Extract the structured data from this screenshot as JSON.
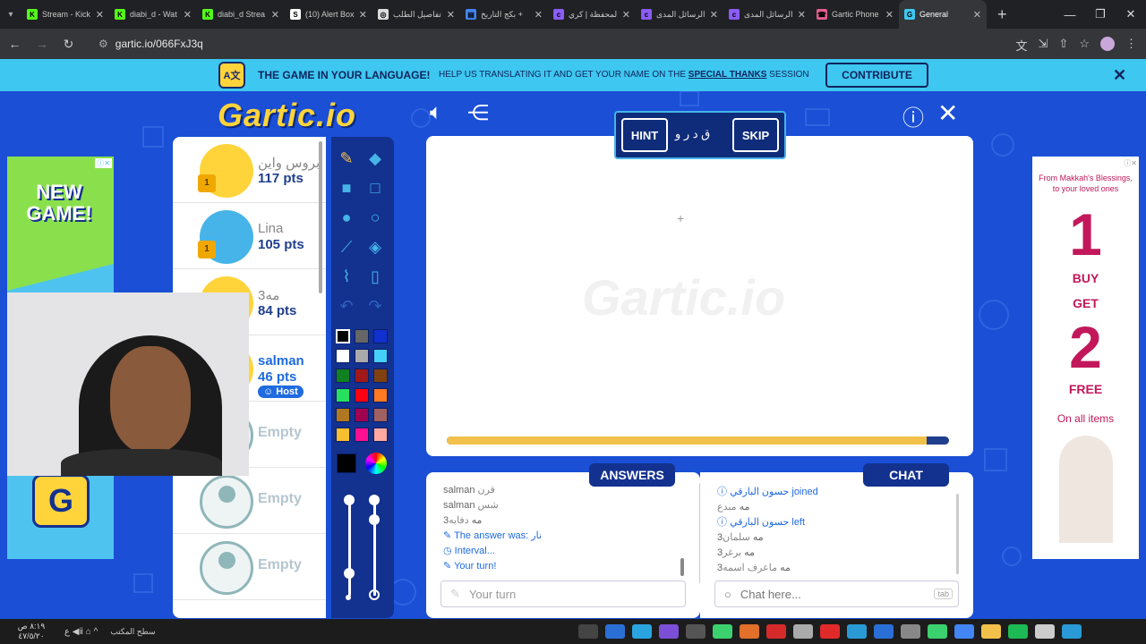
{
  "tabs": [
    {
      "label": "Stream - Kick",
      "color": "#53fc18",
      "glyph": "K"
    },
    {
      "label": "diabi_d - Wat",
      "color": "#53fc18",
      "glyph": "K"
    },
    {
      "label": "diabi_d Strea",
      "color": "#53fc18",
      "glyph": "K"
    },
    {
      "label": "(10) Alert Box",
      "color": "#ffffff",
      "glyph": "S"
    },
    {
      "label": "تفاصيل الطلب",
      "color": "#dddddd",
      "glyph": "◎"
    },
    {
      "label": "بكج التاريخ +",
      "color": "#4285f4",
      "glyph": "▤"
    },
    {
      "label": "المحفظة | كري",
      "color": "#8b5cf6",
      "glyph": "c"
    },
    {
      "label": "الرسائل المدى",
      "color": "#8b5cf6",
      "glyph": "c"
    },
    {
      "label": "الرسائل المدى",
      "color": "#8b5cf6",
      "glyph": "c"
    },
    {
      "label": "Gartic Phone",
      "color": "#e35d8f",
      "glyph": "☎"
    },
    {
      "label": "General",
      "color": "#3ec7f0",
      "glyph": "G"
    }
  ],
  "address": {
    "url": "gartic.io/066FxJ3q"
  },
  "banner": {
    "title": "THE GAME IN YOUR LANGUAGE!",
    "text_prefix": "HELP US TRANSLATING IT AND GET YOUR NAME ON THE",
    "text_bold": "SPECIAL THANKS",
    "text_suffix": "SESSION",
    "contribute_label": "CONTRIBUTE"
  },
  "logo_text": "Gartic.io",
  "players": [
    {
      "name": "بروس واين",
      "pts": "117 pts",
      "avatar": "yellow",
      "trophy": "1"
    },
    {
      "name": "Lina",
      "pts": "105 pts",
      "avatar": "blue",
      "trophy": "1"
    },
    {
      "name": "3مه",
      "pts": "84 pts",
      "avatar": "yellow"
    },
    {
      "name": "salman",
      "pts": "46 pts",
      "avatar": "yellow",
      "host": "Host"
    },
    {
      "name": "Empty",
      "avatar": "empty"
    },
    {
      "name": "Empty",
      "avatar": "empty"
    },
    {
      "name": "Empty",
      "avatar": "empty"
    }
  ],
  "hint": {
    "hint_label": "HINT",
    "word": "ق د ر و",
    "skip_label": "SKIP"
  },
  "canvas": {
    "watermark": "Gartic.io",
    "progress": 0.955
  },
  "colors": [
    "#000000",
    "#666666",
    "#1030d0",
    "#ffffff",
    "#aaaaaa",
    "#46d0f8",
    "#108020",
    "#a01818",
    "#804010",
    "#28e060",
    "#ff0010",
    "#ff7a20",
    "#b07820",
    "#a00050",
    "#a06060",
    "#f8c030",
    "#ff1090",
    "#ffaaa0"
  ],
  "answers": {
    "tab_label": "ANSWERS",
    "messages": [
      {
        "name": "salman",
        "text": "قرن",
        "type": "user"
      },
      {
        "name": "salman",
        "text": "شس",
        "type": "user"
      },
      {
        "name": "3مه",
        "text": "دفايه",
        "type": "user"
      },
      {
        "name": "",
        "text": "The answer was: نار",
        "type": "sys",
        "icon": "✎"
      },
      {
        "name": "",
        "text": "Interval...",
        "type": "sys",
        "icon": "◷"
      },
      {
        "name": "",
        "text": "Your turn!",
        "type": "sys",
        "icon": "✎"
      }
    ],
    "input_placeholder": "Your turn"
  },
  "chat": {
    "tab_label": "CHAT",
    "messages": [
      {
        "name": "",
        "text": "حسون البارقي joined",
        "type": "sys",
        "icon": "ⓘ"
      },
      {
        "name": "مه",
        "text": "مبدع",
        "type": "user"
      },
      {
        "name": "",
        "text": "حسون البارقي left",
        "type": "sys",
        "icon": "ⓘ"
      },
      {
        "name": "3مه",
        "text": "سلمان",
        "type": "user"
      },
      {
        "name": "3مه",
        "text": "برغر",
        "type": "user"
      },
      {
        "name": "3مه",
        "text": "ماعرف اسمه",
        "type": "user"
      }
    ],
    "input_placeholder": "Chat here...",
    "tab_hint": "tab"
  },
  "ads": {
    "left_text": "NEW GAME!",
    "right_header": "From Makkah's Blessings, to your loved ones",
    "right_buy_num": "1",
    "right_buy": "BUY",
    "right_get": "GET",
    "right_get_num": "2",
    "right_free": "FREE",
    "right_footer": "On all items"
  },
  "taskbar": {
    "time": "٨:١٩ ص",
    "date": "٤٧/٥/٢٠",
    "desktop_label": "سطح المكتب"
  }
}
